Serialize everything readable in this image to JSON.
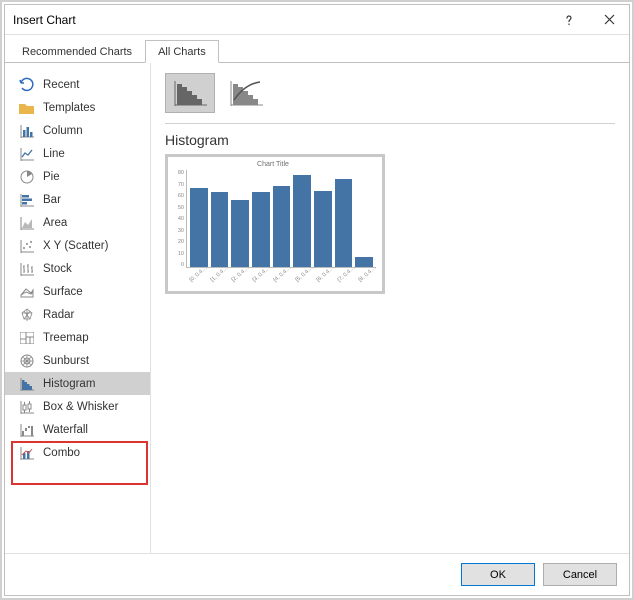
{
  "dialog": {
    "title": "Insert Chart"
  },
  "tabs": {
    "recommended": "Recommended Charts",
    "all": "All Charts"
  },
  "sidebar": {
    "items": [
      {
        "name": "recent",
        "label": "Recent"
      },
      {
        "name": "templates",
        "label": "Templates"
      },
      {
        "name": "column",
        "label": "Column"
      },
      {
        "name": "line",
        "label": "Line"
      },
      {
        "name": "pie",
        "label": "Pie"
      },
      {
        "name": "bar",
        "label": "Bar"
      },
      {
        "name": "area",
        "label": "Area"
      },
      {
        "name": "scatter",
        "label": "X Y (Scatter)"
      },
      {
        "name": "stock",
        "label": "Stock"
      },
      {
        "name": "surface",
        "label": "Surface"
      },
      {
        "name": "radar",
        "label": "Radar"
      },
      {
        "name": "treemap",
        "label": "Treemap"
      },
      {
        "name": "sunburst",
        "label": "Sunburst"
      },
      {
        "name": "histogram",
        "label": "Histogram"
      },
      {
        "name": "box-whisker",
        "label": "Box & Whisker"
      },
      {
        "name": "waterfall",
        "label": "Waterfall"
      },
      {
        "name": "combo",
        "label": "Combo"
      }
    ]
  },
  "main": {
    "heading": "Histogram"
  },
  "footer": {
    "ok": "OK",
    "cancel": "Cancel"
  },
  "chart_data": {
    "type": "bar",
    "title": "Chart Title",
    "categories": [
      "[0, 0.4…",
      "[1, 0.4…",
      "[2, 0.4…",
      "[3, 0.4…",
      "[4, 0.4…",
      "[5, 0.4…",
      "[6, 0.4…",
      "[7, 0.4…",
      "[8, 0.4…"
    ],
    "values": [
      65,
      62,
      55,
      62,
      67,
      76,
      63,
      73,
      8
    ],
    "xlabel": "",
    "ylabel": "",
    "ylim": [
      0,
      80
    ],
    "yticks": [
      0,
      10,
      20,
      30,
      40,
      50,
      60,
      70,
      80
    ]
  }
}
